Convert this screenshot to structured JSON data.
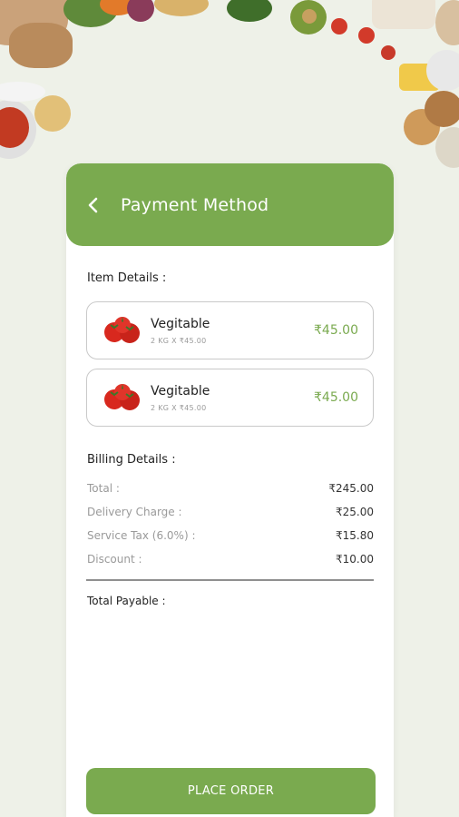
{
  "header": {
    "title": "Payment Method"
  },
  "items_section": {
    "label": "Item Details :"
  },
  "items": [
    {
      "name": "Vegitable",
      "qty": "2 KG X ₹45.00",
      "price": "₹45.00",
      "icon": "tomato-icon"
    },
    {
      "name": "Vegitable",
      "qty": "2 KG X ₹45.00",
      "price": "₹45.00",
      "icon": "tomato-icon"
    }
  ],
  "billing": {
    "label": "Billing Details :",
    "rows": [
      {
        "key": "Total :",
        "value": "₹245.00"
      },
      {
        "key": "Delivery Charge :",
        "value": "₹25.00"
      },
      {
        "key": "Service Tax (6.0%) :",
        "value": "₹15.80"
      },
      {
        "key": "Discount :",
        "value": "₹10.00"
      }
    ],
    "total_payable_label": "Total Payable :"
  },
  "actions": {
    "place_order": "PLACE ORDER"
  },
  "colors": {
    "accent": "#7aaa4f",
    "background": "#eef1e8"
  }
}
